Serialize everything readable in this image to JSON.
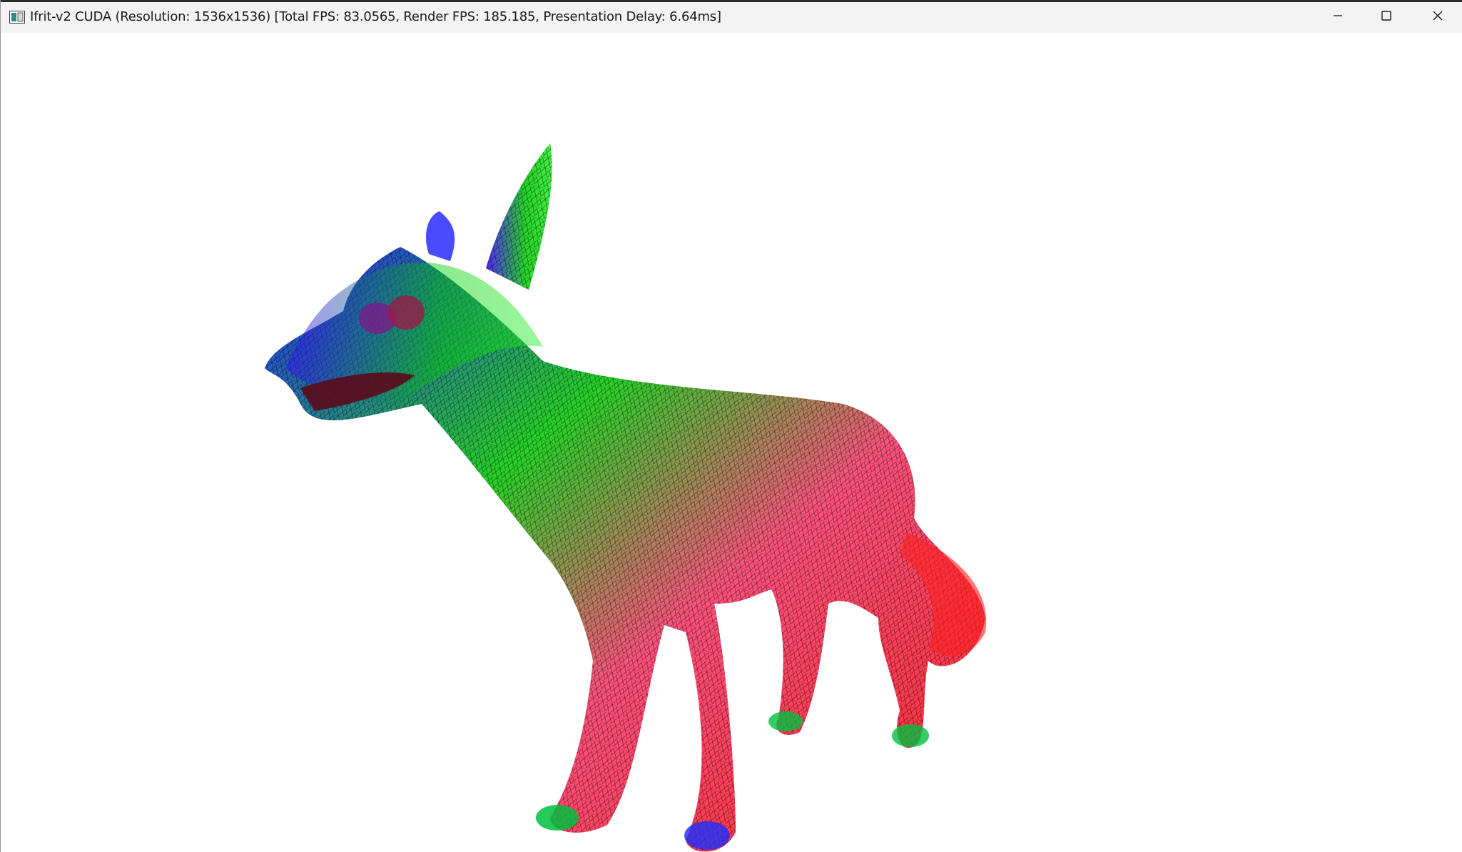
{
  "window": {
    "title": "Ifrit-v2 CUDA (Resolution: 1536x1536) [Total FPS: 83.0565, Render FPS: 185.185, Presentation Delay: 6.64ms]",
    "app_icon": "app-window-icon",
    "controls": {
      "minimize_icon": "minimize-icon",
      "maximize_icon": "maximize-icon",
      "close_icon": "close-icon"
    }
  },
  "viewport": {
    "content": "wireframe-wolf-mesh",
    "background": "#ffffff",
    "mesh_colors": [
      "#ff0000",
      "#00cc00",
      "#0000ff"
    ]
  }
}
